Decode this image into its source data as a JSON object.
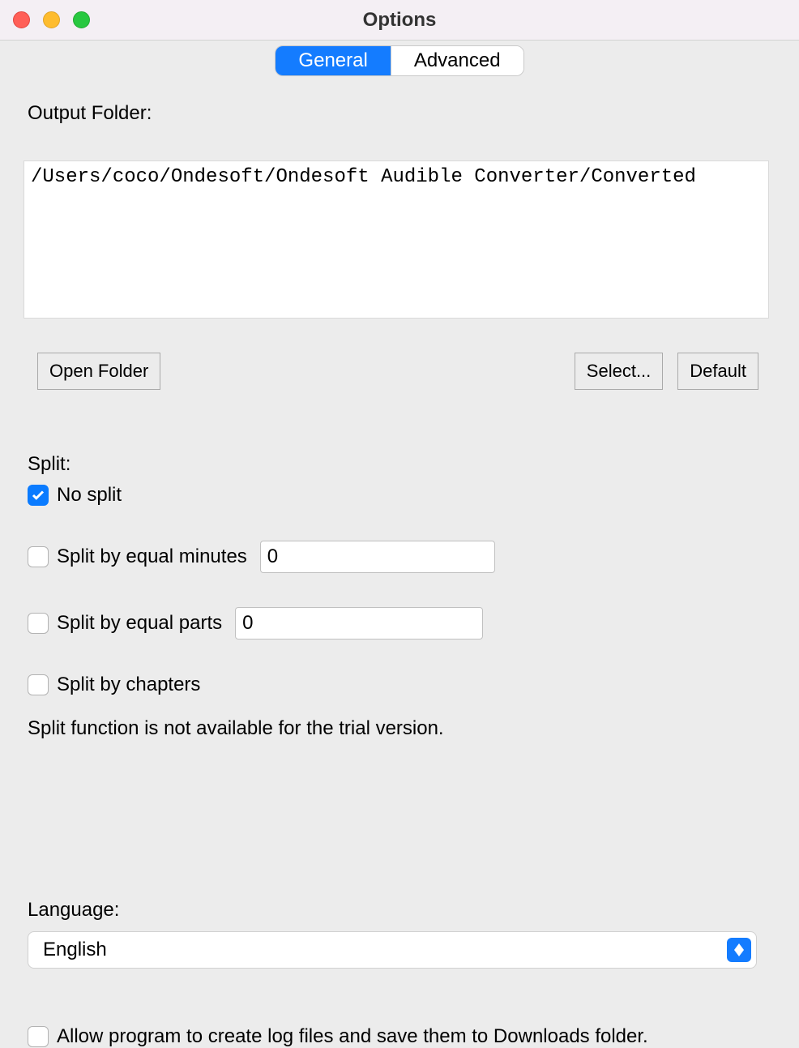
{
  "window": {
    "title": "Options"
  },
  "tabs": {
    "general": "General",
    "advanced": "Advanced",
    "active": "general"
  },
  "output": {
    "label": "Output Folder:",
    "path": "/Users/coco/Ondesoft/Ondesoft Audible Converter/Converted",
    "open_folder_btn": "Open Folder",
    "select_btn": "Select...",
    "default_btn": "Default"
  },
  "split": {
    "label": "Split:",
    "no_split": {
      "label": "No split",
      "checked": true
    },
    "by_minutes": {
      "label": "Split by equal minutes",
      "checked": false,
      "value": "0"
    },
    "by_parts": {
      "label": "Split by equal parts",
      "checked": false,
      "value": "0"
    },
    "by_chapters": {
      "label": "Split by chapters",
      "checked": false
    },
    "note": "Split function is not available for the trial version."
  },
  "language": {
    "label": "Language:",
    "value": "English"
  },
  "log": {
    "label": "Allow program to create log files and save them to Downloads folder.",
    "checked": false
  }
}
